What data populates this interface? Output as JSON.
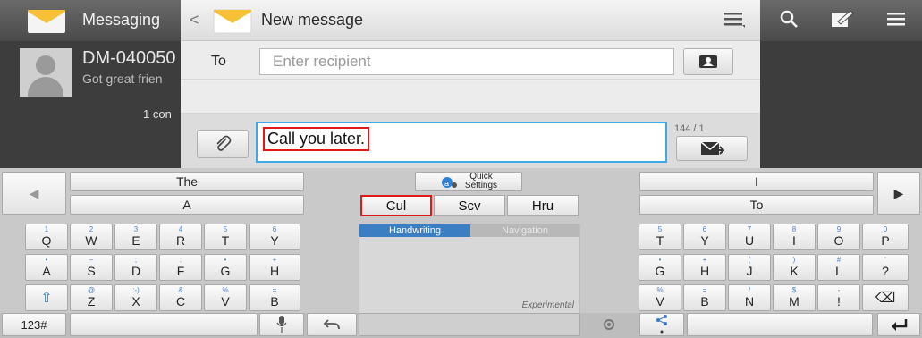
{
  "background_app": {
    "title": "Messaging",
    "conversation": {
      "name": "DM-040050",
      "snippet": "Got great frien",
      "count": "1 con"
    },
    "icons": [
      "hamburger-icon",
      "search-icon",
      "compose-icon",
      "menu-icon"
    ]
  },
  "dialog": {
    "back": "<",
    "title": "New message",
    "to_label": "To",
    "recipient_placeholder": "Enter recipient",
    "message_text": "Call you later.",
    "counter": "144 / 1"
  },
  "keyboard": {
    "left_suggestions": [
      "The",
      "A"
    ],
    "right_suggestions": [
      "I",
      "To"
    ],
    "quick_settings_line1": "Quick",
    "quick_settings_line2": "Settings",
    "candidates": [
      "Cul",
      "Scv",
      "Hru"
    ],
    "handwriting_tab": "Handwriting",
    "navigation_tab": "Navigation",
    "experimental": "Experimental",
    "left_rows": [
      [
        {
          "main": "Q",
          "sub": "1"
        },
        {
          "main": "W",
          "sub": "2"
        },
        {
          "main": "E",
          "sub": "3"
        },
        {
          "main": "R",
          "sub": "4"
        },
        {
          "main": "T",
          "sub": "5"
        },
        {
          "main": "Y",
          "sub": "6"
        }
      ],
      [
        {
          "main": "A",
          "sub": "•"
        },
        {
          "main": "S",
          "sub": "–"
        },
        {
          "main": "D",
          "sub": ";"
        },
        {
          "main": "F",
          "sub": ":"
        },
        {
          "main": "G",
          "sub": "•"
        },
        {
          "main": "H",
          "sub": "+"
        }
      ],
      [
        {
          "main": "⇧",
          "sub": ""
        },
        {
          "main": "Z",
          "sub": "@"
        },
        {
          "main": "X",
          "sub": ":-)"
        },
        {
          "main": "C",
          "sub": "&"
        },
        {
          "main": "V",
          "sub": "%"
        },
        {
          "main": "B",
          "sub": "="
        }
      ]
    ],
    "right_rows": [
      [
        {
          "main": "T",
          "sub": "5"
        },
        {
          "main": "Y",
          "sub": "6"
        },
        {
          "main": "U",
          "sub": "7"
        },
        {
          "main": "I",
          "sub": "8"
        },
        {
          "main": "O",
          "sub": "9"
        },
        {
          "main": "P",
          "sub": "0"
        }
      ],
      [
        {
          "main": "G",
          "sub": "•"
        },
        {
          "main": "H",
          "sub": "+"
        },
        {
          "main": "J",
          "sub": "("
        },
        {
          "main": "K",
          "sub": ")"
        },
        {
          "main": "L",
          "sub": "#"
        },
        {
          "main": "?",
          "sub": "'"
        }
      ],
      [
        {
          "main": "V",
          "sub": "%"
        },
        {
          "main": "B",
          "sub": "="
        },
        {
          "main": "N",
          "sub": "/"
        },
        {
          "main": "M",
          "sub": "$"
        },
        {
          "main": "!",
          "sub": "-"
        },
        {
          "main": "⌫",
          "sub": ""
        }
      ]
    ],
    "mode_key": "123#"
  },
  "colors": {
    "accent": "#3fa9e8",
    "highlight": "#e01818",
    "handwriting_tab": "#3c7ec2",
    "navigation_tab": "#b8b8b8"
  }
}
